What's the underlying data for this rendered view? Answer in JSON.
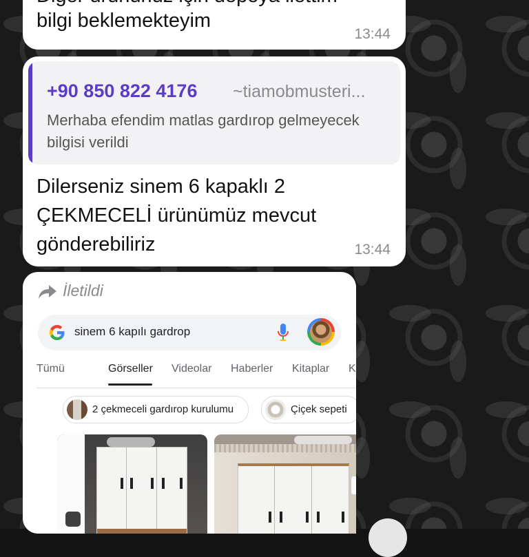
{
  "messages": [
    {
      "text": "Diğer ürününüz için depoya ilettim bilgi beklemekteyim",
      "time": "13:44"
    },
    {
      "quote": {
        "phone": "+90 850 822 4176",
        "name": "~tiamobmusteri...",
        "text": "Merhaba efendim matlas gardırop gelmeyecek bilgisi verildi"
      },
      "text": "Dilerseniz sinem 6 kapaklı 2 ÇEKMECELİ ürünümüz mevcut gönderebiliriz",
      "time": "13:44"
    }
  ],
  "forwarded": {
    "label": "İletildi",
    "screenshot": {
      "search_query": "sinem 6 kapılı gardrop",
      "tabs": [
        "Tümü",
        "Görseller",
        "Videolar",
        "Haberler",
        "Kitaplar",
        "Kısa"
      ],
      "active_tab": "Görseller",
      "chips": [
        "2 çekmeceli gardırop kurulumu",
        "Çiçek sepeti"
      ]
    }
  },
  "colors": {
    "quote_accent": "#5b3cc4",
    "bubble": "#ffffff",
    "timestamp": "#8a8a8e"
  },
  "icons": [
    "forward-arrow-icon",
    "google-g-icon",
    "microphone-icon",
    "profile-avatar-icon"
  ]
}
